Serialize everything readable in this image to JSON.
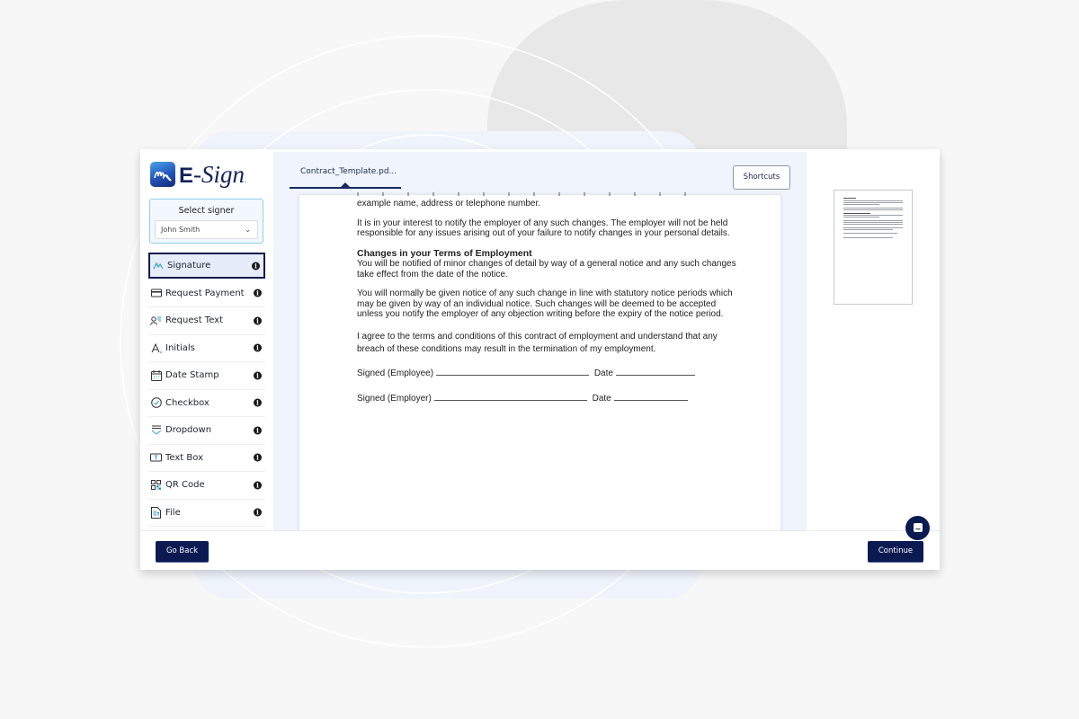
{
  "app": {
    "logo_text_e": "E",
    "logo_text_sign": "-Sign",
    "logo_dot": "."
  },
  "signer": {
    "label": "Select signer",
    "selected": "John Smith"
  },
  "fields": [
    {
      "label": "Signature",
      "icon": "signature-icon",
      "active": true
    },
    {
      "label": "Request Payment",
      "icon": "credit-card-icon"
    },
    {
      "label": "Request Text",
      "icon": "person-text-icon"
    },
    {
      "label": "Initials",
      "icon": "initials-icon"
    },
    {
      "label": "Date Stamp",
      "icon": "calendar-icon"
    },
    {
      "label": "Checkbox",
      "icon": "checkbox-icon"
    },
    {
      "label": "Dropdown",
      "icon": "dropdown-icon"
    },
    {
      "label": "Text Box",
      "icon": "text-box-icon"
    },
    {
      "label": "QR Code",
      "icon": "qr-code-icon"
    },
    {
      "label": "File",
      "icon": "file-icon"
    }
  ],
  "info_glyph": "i",
  "viewer": {
    "file_tab": "Contract_Template.pd...",
    "shortcuts_label": "Shortcuts"
  },
  "document": {
    "p0": "example name, address or telephone number.",
    "p1": "It is in your interest to notify the employer of any such changes. The employer will not be held responsible for any issues arising out of your failure to notify changes in your personal details.",
    "heading": "Changes in your Terms of Employment",
    "p2": "You will be notified of minor changes of detail by way of a general notice and any such changes take effect from the date of the notice.",
    "p3": "You will normally be given notice of any such change in line with statutory notice periods which may be given by way of an individual notice. Such changes will be deemed to be accepted unless you notify the employer of any objection writing before the expiry of the notice period.",
    "p4": "I agree to the terms and conditions of this contract of employment and understand that any breach of these conditions may result in the termination of my employment.",
    "sign_employee": "Signed (Employee)",
    "sign_employer": "Signed (Employer)",
    "date_label": "Date"
  },
  "footer": {
    "go_back": "Go Back",
    "continue": "Continue"
  }
}
